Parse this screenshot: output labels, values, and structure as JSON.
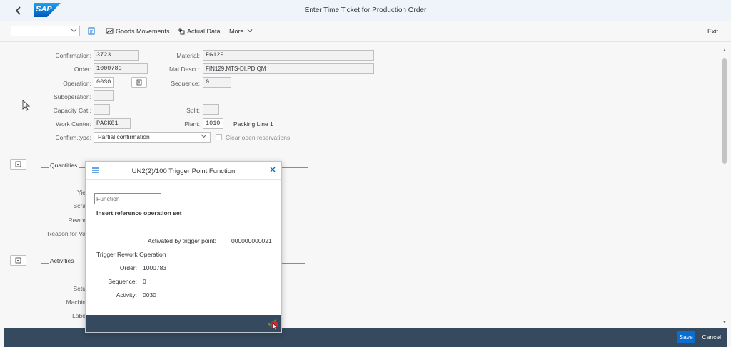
{
  "shell": {
    "logo_text": "SAP",
    "title": "Enter Time Ticket for Production Order"
  },
  "toolbar": {
    "select_value": "",
    "goods_movements": "Goods Movements",
    "actual_data": "Actual Data",
    "more": "More",
    "exit": "Exit"
  },
  "form": {
    "confirmation": {
      "label": "Confirmation:",
      "value": "3723"
    },
    "order": {
      "label": "Order:",
      "value": "1000783"
    },
    "operation": {
      "label": "Operation:",
      "value": "0030"
    },
    "suboperation": {
      "label": "Suboperation:",
      "value": ""
    },
    "capacity_cat": {
      "label": "Capacity Cat.:",
      "value": ""
    },
    "work_center": {
      "label": "Work Center:",
      "value": "PACK01"
    },
    "confirm_type": {
      "label": "Confirm.type:",
      "value": "Partial confirmation"
    },
    "material": {
      "label": "Material:",
      "value": "FG129"
    },
    "mat_descr": {
      "label": "Mat.Descr.:",
      "value": "FIN129,MTS-DI,PD,QM"
    },
    "sequence": {
      "label": "Sequence:",
      "value": "0"
    },
    "split": {
      "label": "Split:",
      "value": ""
    },
    "plant": {
      "label": "Plant:",
      "value": "1010",
      "desc": "Packing Line 1"
    },
    "clear_open_res": "Clear open reservations"
  },
  "quantities": {
    "title": "Quantities",
    "labels": [
      "Yie",
      "Scra",
      "Rewor",
      "Reason for Va"
    ]
  },
  "activities": {
    "title": "Activities",
    "labels": [
      "Setu",
      "Machin",
      "Labo"
    ]
  },
  "footer": {
    "save": "Save",
    "cancel": "Cancel"
  },
  "dialog": {
    "title": "UN2(2)/100 Trigger Point Function",
    "function_placeholder": "Function",
    "insert_ref": "Insert reference operation set",
    "activated_label": "Activated by trigger point:",
    "activated_value": "000000000021",
    "trigger_rework": "Trigger Rework Operation",
    "order_label": "Order:",
    "order_value": "1000783",
    "sequence_label": "Sequence:",
    "sequence_value": "0",
    "activity_label": "Activity:",
    "activity_value": "0030"
  },
  "colors": {
    "shell_bg": "#eef4fa",
    "footer_bg": "#354a5f",
    "accent": "#0a6ed1"
  }
}
